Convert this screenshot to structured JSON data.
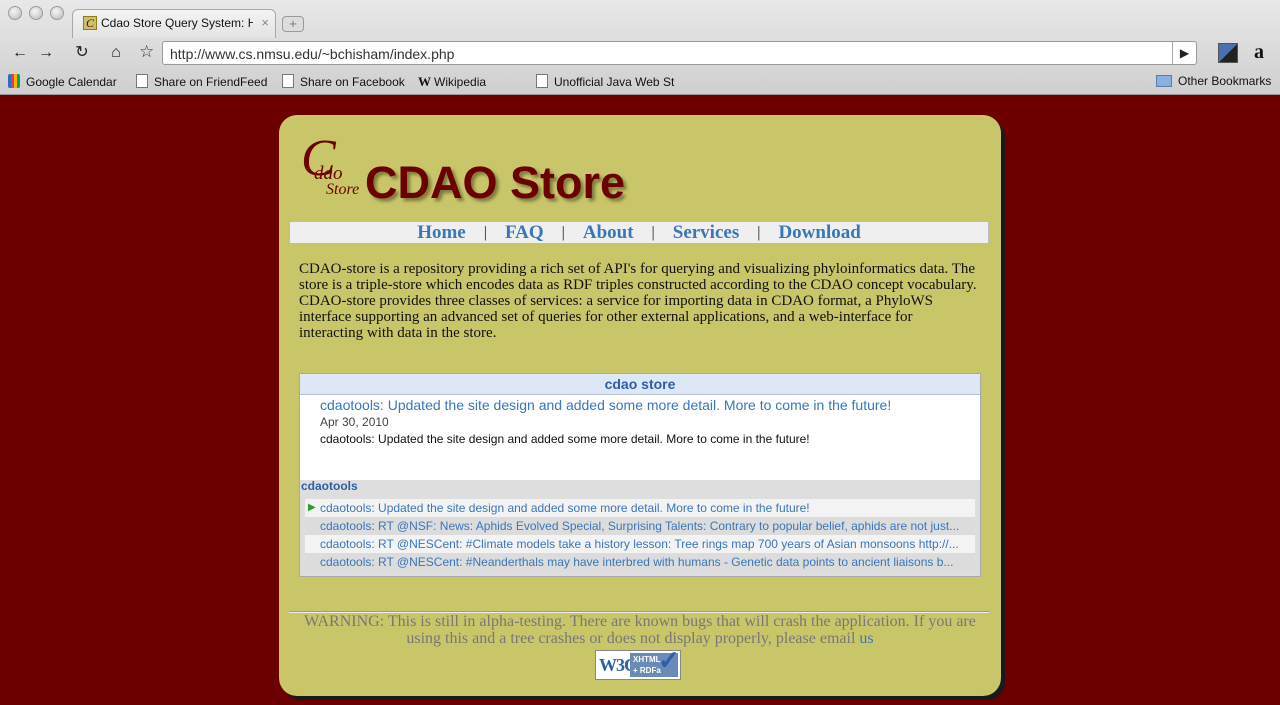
{
  "browser": {
    "tab_title": "Cdao Store Query System: Home",
    "tab_close": "×",
    "new_tab": "+",
    "url": "http://www.cs.nmsu.edu/~bchisham/index.php",
    "bookmarks": [
      {
        "label": "Google Calendar",
        "icon": "google-icon"
      },
      {
        "label": "Share on FriendFeed",
        "icon": "page-icon"
      },
      {
        "label": "Share on Facebook",
        "icon": "page-icon"
      },
      {
        "label": "Wikipedia",
        "icon": "wikipedia-icon"
      },
      {
        "label": "Unofficial Java Web St",
        "icon": "page-icon"
      }
    ],
    "other_bookmarks": "Other Bookmarks"
  },
  "logo": {
    "c": "C",
    "dao": "dao",
    "store": "Store"
  },
  "site_title": "CDAO Store",
  "nav": [
    "Home",
    "FAQ",
    "About",
    "Services",
    "Download"
  ],
  "nav_separator": "|",
  "intro": "CDAO-store is a repository providing a rich set of API's for querying and visualizing phyloinformatics data. The store is a triple-store which encodes data as RDF triples constructed according to the CDAO concept vocabulary. CDAO-store provides three classes of services: a service for importing data in CDAO format, a PhyloWS interface supporting an advanced set of queries for other external applications, and a web-interface for interacting with data in the store.",
  "feed": {
    "header": "cdao store",
    "entry_title": "cdaotools: Updated the site design and added some more detail. More to come in the future!",
    "entry_date": "Apr 30, 2010",
    "entry_text": "cdaotools: Updated the site design and added some more detail. More to come in the future!",
    "source": "cdaotools",
    "items": [
      "cdaotools: Updated the site design and added some more detail. More to come in the future!",
      "cdaotools: RT @NSF: News: Aphids Evolved Special, Surprising Talents: Contrary to popular belief, aphids are not just...",
      "cdaotools: RT @NESCent: #Climate models take a history lesson: Tree rings map 700 years of Asian monsoons http://...",
      "cdaotools: RT @NESCent: #Neanderthals may have interbred with humans - Genetic data points to ancient liaisons b..."
    ]
  },
  "warning": "WARNING: This is still in alpha-testing. There are known bugs that will crash the application. If you are using this and a tree crashes or does not display properly, please email",
  "warning_link": "us",
  "w3c": {
    "logo": "W3C",
    "line1": "XHTML",
    "line2": "+ RDFa"
  },
  "colors": {
    "background": "#6b0000",
    "panel": "#c9c66a",
    "link": "#3a76b8",
    "title": "#6b0000"
  }
}
